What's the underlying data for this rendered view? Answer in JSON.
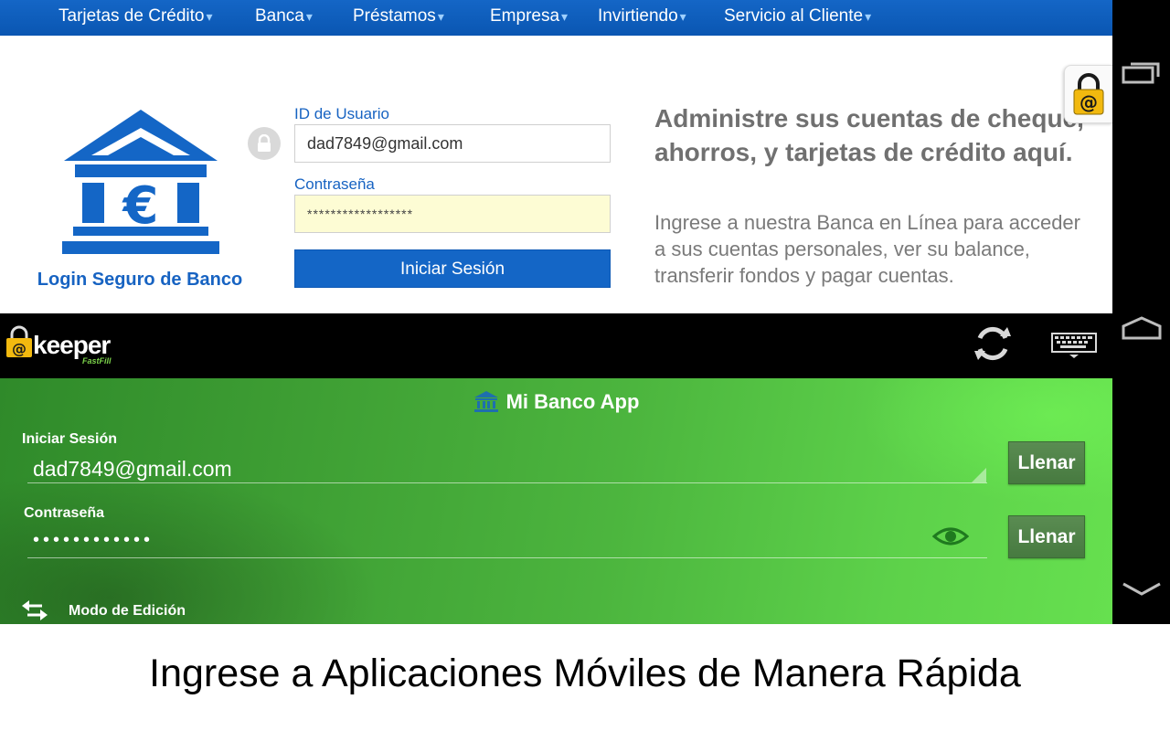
{
  "nav": {
    "items": [
      {
        "label": "Tarjetas de Crédito"
      },
      {
        "label": "Banca"
      },
      {
        "label": "Préstamos"
      },
      {
        "label": "Empresa"
      },
      {
        "label": "Invirtiendo"
      },
      {
        "label": "Servicio al Cliente"
      }
    ],
    "caret": "▾"
  },
  "login": {
    "caption": "Login Seguro de Banco",
    "user_label": "ID de Usuario",
    "user_value": "dad7849@gmail.com",
    "password_label": "Contraseña",
    "password_value": "******************",
    "submit_label": "Iniciar Sesión"
  },
  "promo": {
    "title": "Administre sus cuentas de cheque, ahorros, y tarjetas de crédito aquí.",
    "body": "Ingrese a nuestra Banca en Línea para acceder a sus cuentas personales, ver su balance, transferir fondos y pagar cuentas."
  },
  "keeper": {
    "logo_text": "keeper",
    "logo_sub": "FastFill",
    "panel_title": "Mi Banco App",
    "login_label": "Iniciar Sesión",
    "login_value": "dad7849@gmail.com",
    "password_label": "Contraseña",
    "password_value": "••••••••••••",
    "fill_label": "Llenar",
    "edit_mode_label": "Modo de Edición"
  },
  "caption": "Ingrese a Aplicaciones Móviles de Manera Rápida",
  "colors": {
    "brand_blue": "#1466c6",
    "keeper_green": "#4cb53e",
    "keeper_gold": "#f2b90f"
  }
}
